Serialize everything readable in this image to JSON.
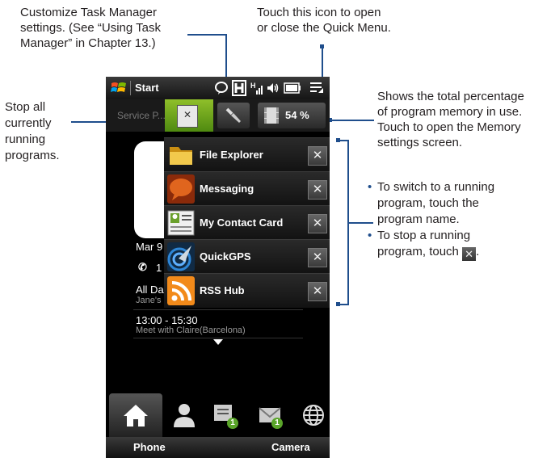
{
  "callouts": {
    "customize": [
      "Customize Task Manager",
      "settings. (See “Using Task",
      "Manager” in Chapter 13.)"
    ],
    "quick_menu": [
      "Touch this icon to open",
      "or close the Quick Menu."
    ],
    "stop_all": [
      "Stop all",
      "currently",
      "running",
      "programs."
    ],
    "memory": [
      "Shows the total percentage",
      "of program memory in use.",
      "Touch to open the Memory",
      "settings screen."
    ],
    "switch_bullet": [
      "To switch to a running",
      "program, touch the",
      "program name."
    ],
    "stop_bullet": [
      "To stop a running",
      "program, touch"
    ],
    "stop_bullet_end": "."
  },
  "status_bar": {
    "start_label": "Start",
    "icons": [
      "chat-bubble-icon",
      "h-box-icon",
      "signal-icon",
      "volume-icon",
      "battery-icon",
      "quick-menu-icon"
    ]
  },
  "quick_menu_bar": {
    "service_label": "Service P...",
    "memory_percent": "54 %"
  },
  "home": {
    "date": "Mar 9",
    "missed": "1",
    "all_day": "All Da",
    "janes": "Jane's",
    "event_time": "13:00 - 15:30",
    "event_desc": "Meet with Claire(Barcelona)"
  },
  "running_programs": [
    {
      "name": "File Explorer",
      "icon": "folder-icon",
      "color": "#e8b42a"
    },
    {
      "name": "Messaging",
      "icon": "messaging-icon",
      "color": "#d0541a"
    },
    {
      "name": "My Contact Card",
      "icon": "contact-card-icon",
      "color": "#7aa23c"
    },
    {
      "name": "QuickGPS",
      "icon": "gps-icon",
      "color": "#2a6fb8"
    },
    {
      "name": "RSS Hub",
      "icon": "rss-icon",
      "color": "#f28a1a"
    }
  ],
  "close_symbol": "✕",
  "tabs": {
    "badge_messages": "1",
    "badge_mail": "1"
  },
  "softkeys": {
    "left": "Phone",
    "right": "Camera"
  },
  "colors": {
    "callout_line": "#1f4e8c",
    "task_manager_green": "#6aa31c"
  }
}
